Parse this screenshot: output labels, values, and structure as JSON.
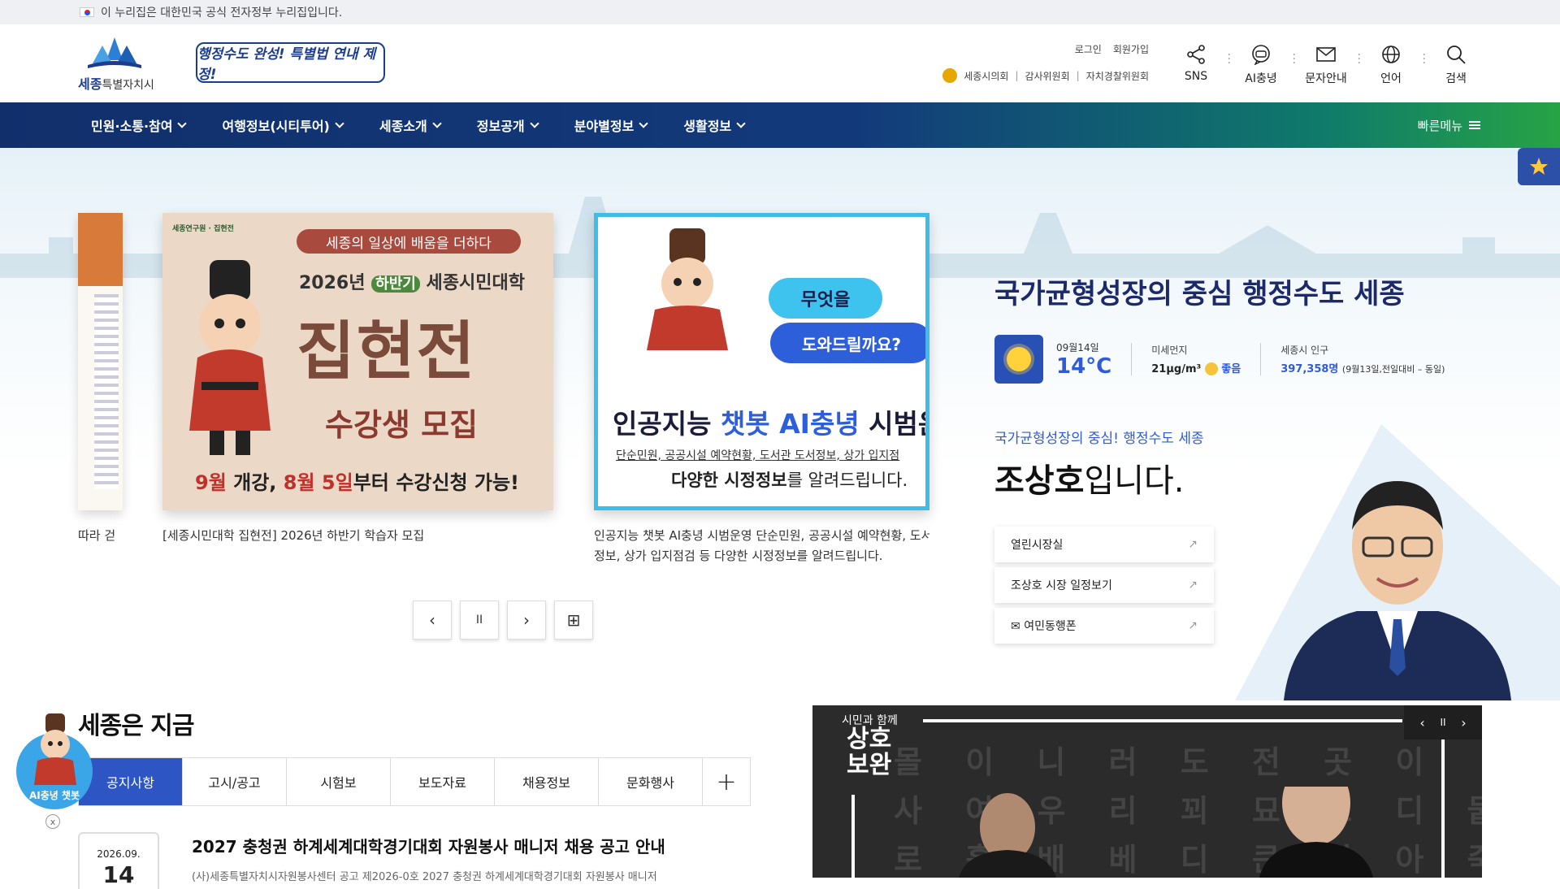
{
  "gov_banner": {
    "text": "이 누리집은 대한민국 공식 전자정부 누리집입니다."
  },
  "header": {
    "logo_main": "세종",
    "logo_sub": "특별자치시",
    "slogan": "행정수도 완성! 특별법 연내 제정!",
    "login": "로그인",
    "signup": "회원가입",
    "links": [
      "세종시의회",
      "감사위원회",
      "자치경찰위원회"
    ],
    "icons": [
      {
        "label": "SNS",
        "icon": "share-icon"
      },
      {
        "label": "AI충녕",
        "icon": "ai-chat-icon"
      },
      {
        "label": "문자안내",
        "icon": "mail-icon"
      },
      {
        "label": "언어",
        "icon": "globe-icon"
      },
      {
        "label": "검색",
        "icon": "search-icon"
      }
    ]
  },
  "nav": {
    "items": [
      "민원·소통·참여",
      "여행정보(시티투어)",
      "세종소개",
      "정보공개",
      "분야별정보",
      "생활정보"
    ],
    "quick_menu": "빠른메뉴"
  },
  "slides": {
    "partial_caption": "따라 걷",
    "card1": {
      "banner": "세종의 일상에 배움을 더하다",
      "logos": "세종연구원 · 집현전",
      "sub_prefix": "2026년",
      "sub_hl": "하반기",
      "sub_suffix": "세종시민대학",
      "title": "집현전",
      "title2": "수강생 모집",
      "date_a": "9월",
      "date_b": " 개강, ",
      "date_c": "8월 5일",
      "date_d": "부터 수강신청 가능!",
      "caption": "[세종시민대학 집현전] 2026년 하반기 학습자 모집"
    },
    "card2": {
      "bubble1": "무엇을",
      "bubble2": "도와드릴까요?",
      "title_a": "인공지능 ",
      "title_b": "챗봇 AI충녕",
      "title_c": " 시범운",
      "sub": "단순민원, 공공시설 예약현황, 도서관 도서정보, 상가 입지점",
      "sub2_a": "다양한 시정정보",
      "sub2_b": "를 알려드립니다.",
      "caption_line1": "인공지능 챗봇 AI충녕 시범운영 단순민원, 공공시설 예약현황, 도서",
      "caption_line2": "정보, 상가 입지점검 등 다양한 시정정보를 알려드립니다."
    },
    "controls": {
      "prev": "‹",
      "pause": "II",
      "next": "›",
      "all": "⊞"
    }
  },
  "right_panel": {
    "title": "국가균형성장의 중심 행정수도 세종",
    "weather": {
      "date": "09월14일",
      "temp": "14°C",
      "icon": "sun-icon"
    },
    "dust": {
      "label": "미세먼지",
      "value": "21μg/m³",
      "status": "좋음"
    },
    "population": {
      "label": "세종시 인구",
      "value": "397,358명",
      "note": "(9월13일,전일대비 – 동일)"
    },
    "mayor_sub": "국가균형성장의 중심! 행정수도 세종",
    "mayor_name": "조상호",
    "mayor_suffix": "입니다.",
    "buttons": [
      "열린시장실",
      "조상호 시장 일정보기",
      "여민동행폰"
    ]
  },
  "news": {
    "title": "세종은 지금",
    "tabs": [
      "공지사항",
      "고시/공고",
      "시험보",
      "보도자료",
      "채용정보",
      "문화행사"
    ],
    "plus": "+",
    "item": {
      "date_ym": "2026.09.",
      "date_d": "14",
      "title": "2027 충청권 하계세계대학경기대회 자원봉사 매니저 채용 공고 안내",
      "body": "(사)세종특별자치시자원봉사센터 공고 제2026-0호 2027 충청권 하계세계대학경기대회 자원봉사 매니저"
    }
  },
  "chatbot": {
    "label": "AI충녕 챗봇",
    "close": "x"
  },
  "video": {
    "small": "시민과 함께",
    "big": "상호\n보완",
    "grid_line1": "몰 이 니 러 도 전 곳 이",
    "grid_line2": "사 여 우 리 꾀 묘 츠 디 뭍",
    "grid_line3": "로 흙 배 베 디 큰 의 아 죽"
  },
  "colors": {
    "accent": "#2d55c4",
    "nav_start": "#112f6b",
    "nav_end": "#27a346",
    "title": "#1c2a6b"
  }
}
